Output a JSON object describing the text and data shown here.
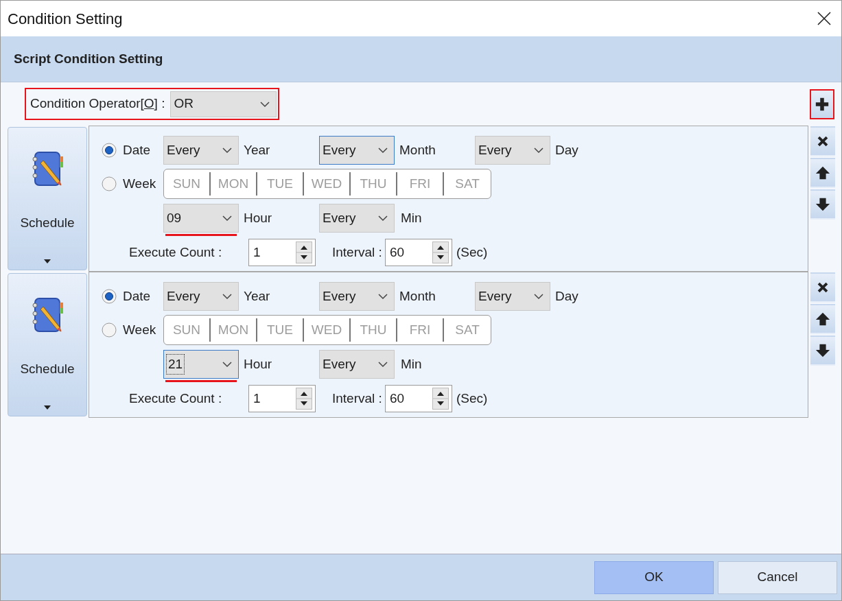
{
  "window": {
    "title": "Condition Setting"
  },
  "header": {
    "title": "Script Condition Setting"
  },
  "operator": {
    "label": "Condition Operator[",
    "access_key": "O",
    "suffix": "] :",
    "value": "OR",
    "highlighted": true
  },
  "add_button": {
    "kind": "add",
    "highlighted": true
  },
  "conditions": [
    {
      "type": "Schedule",
      "options": [
        {
          "label": "Date",
          "selected": true
        },
        {
          "label": "Week",
          "selected": false
        }
      ],
      "date_values": [
        {
          "value": "Every",
          "focused": false
        },
        {
          "value": "Every",
          "focused": true
        },
        {
          "value": "Every",
          "focused": false
        }
      ],
      "date_units": [
        "Year",
        "Month",
        "Day"
      ],
      "weekdays": [
        {
          "label": "SUN",
          "disabled": true
        },
        {
          "label": "MON",
          "disabled": true
        },
        {
          "label": "TUE",
          "disabled": true
        },
        {
          "label": "WED",
          "disabled": true
        },
        {
          "label": "THU",
          "disabled": true
        },
        {
          "label": "FRI",
          "disabled": true
        },
        {
          "label": "SAT",
          "disabled": true
        }
      ],
      "hour": {
        "value": "09",
        "label": "Hour",
        "focused": false,
        "highlighted": true
      },
      "min": {
        "value": "Every",
        "label": "Min",
        "focused": false
      },
      "count": {
        "label": "Execute Count :",
        "value": "1"
      },
      "interval": {
        "label": "Interval :",
        "value": "60",
        "unit": "(Sec)"
      },
      "actions": [
        {
          "kind": "delete"
        },
        {
          "kind": "up"
        },
        {
          "kind": "down"
        }
      ]
    },
    {
      "type": "Schedule",
      "options": [
        {
          "label": "Date",
          "selected": true
        },
        {
          "label": "Week",
          "selected": false
        }
      ],
      "date_values": [
        {
          "value": "Every",
          "focused": false
        },
        {
          "value": "Every",
          "focused": false
        },
        {
          "value": "Every",
          "focused": false
        }
      ],
      "date_units": [
        "Year",
        "Month",
        "Day"
      ],
      "weekdays": [
        {
          "label": "SUN",
          "disabled": true
        },
        {
          "label": "MON",
          "disabled": true
        },
        {
          "label": "TUE",
          "disabled": true
        },
        {
          "label": "WED",
          "disabled": true
        },
        {
          "label": "THU",
          "disabled": true
        },
        {
          "label": "FRI",
          "disabled": true
        },
        {
          "label": "SAT",
          "disabled": true
        }
      ],
      "hour": {
        "value": "21",
        "label": "Hour",
        "focused": true,
        "highlighted": true
      },
      "min": {
        "value": "Every",
        "label": "Min",
        "focused": false
      },
      "count": {
        "label": "Execute Count :",
        "value": "1"
      },
      "interval": {
        "label": "Interval :",
        "value": "60",
        "unit": "(Sec)"
      },
      "actions": [
        {
          "kind": "delete"
        },
        {
          "kind": "up"
        },
        {
          "kind": "down"
        }
      ]
    }
  ],
  "buttons": [
    {
      "label": "OK",
      "default": true
    },
    {
      "label": "Cancel",
      "default": false
    }
  ]
}
